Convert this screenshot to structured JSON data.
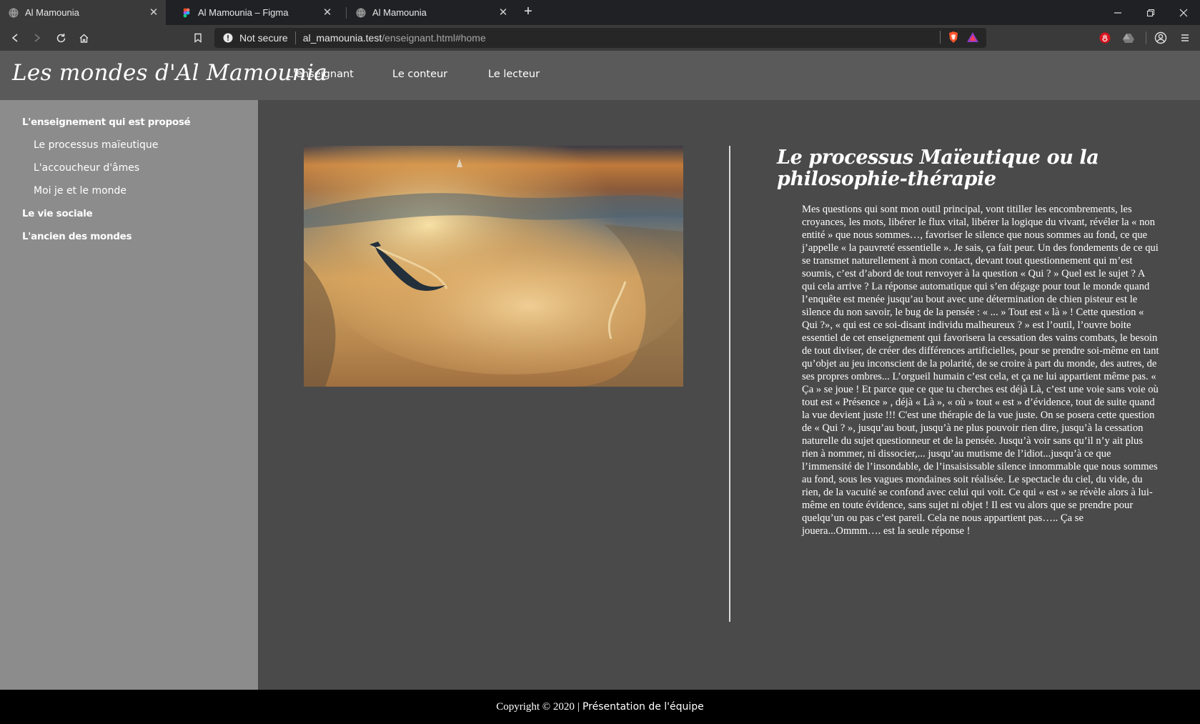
{
  "browser": {
    "tabs": [
      {
        "title": "Al Mamounia",
        "icon": "globe-icon",
        "active": true
      },
      {
        "title": "Al Mamounia – Figma",
        "icon": "figma-icon",
        "active": false
      },
      {
        "title": "Al Mamounia",
        "icon": "globe-icon",
        "active": false
      }
    ],
    "security_label": "Not secure",
    "url_host": "al_mamounia.test",
    "url_path": "/enseignant.html#home"
  },
  "site": {
    "logo": "Les mondes d'Al Mamounia",
    "nav": [
      {
        "label": "L'enseignant"
      },
      {
        "label": "Le conteur"
      },
      {
        "label": "Le lecteur"
      }
    ],
    "sidebar": {
      "section1": "L'enseignement qui est proposé",
      "sub": [
        {
          "label": "Le processus maïeutique"
        },
        {
          "label": "L'accoucheur d'âmes"
        },
        {
          "label": "Moi je et le monde"
        }
      ],
      "section2": "Le vie sociale",
      "section3": "L'ancien des mondes"
    },
    "article": {
      "title": "Le processus Maïeutique ou la philosophie-thérapie",
      "body": "Mes questions qui sont mon outil principal, vont titiller les encombrements, les croyances, les mots, libérer le flux vital, libérer la logique du vivant, révéler la « non entité » que nous sommes…, favoriser le silence que nous sommes au fond, ce que j’appelle « la pauvreté essentielle ». Je sais, ça fait peur. Un des fondements de ce qui se transmet naturellement à mon contact, devant tout questionnement qui m’est soumis, c’est d’abord de tout renvoyer à la question « Qui ? » Quel est le sujet ? A qui cela arrive ? La réponse automatique qui s’en dégage pour tout le monde quand l’enquête est menée jusqu’au bout avec une détermination de chien pisteur est le silence du non savoir, le bug de la pensée : « ... » Tout est « là » ! Cette question « Qui ?», « qui est ce soi-disant individu malheureux ? » est l’outil, l’ouvre boite essentiel de cet enseignement qui favorisera la cessation des vains combats, le besoin de tout diviser, de créer des différences artificielles, pour se prendre soi-même en tant qu’objet au jeu inconscient de la polarité, de se croire à part du monde, des autres, de ses propres ombres... L’orgueil humain c’est cela, et ça ne lui appartient même pas. « Ça » se joue ! Et parce que ce que tu cherches est déjà Là, c’est une voie sans voie où tout est « Présence » , déjà « Là », « où » tout « est » d’évidence, tout de suite quand la vue devient juste !!! C'est une thérapie de la vue juste. On se posera cette question de « Qui ? », jusqu’au bout, jusqu’à ne plus pouvoir rien dire, jusqu’à la cessation naturelle du sujet questionneur et de la pensée. Jusqu’à voir sans qu’il n’y ait plus rien à nommer, ni dissocier,... jusqu’au mutisme de l’idiot...jusqu’à ce que l’immensité de l’insondable, de l’insaisissable silence innommable que nous sommes au fond, sous les vagues mondaines soit réalisée. Le spectacle du ciel, du vide, du rien, de la vacuité se confond avec celui qui voit. Ce qui « est » se révèle alors à lui-même en toute évidence, sans sujet ni objet ! Il est vu alors que se prendre pour quelqu’un ou pas c’est pareil. Cela ne nous appartient pas….. Ça se jouera...Ommm…. est la seule réponse !"
    },
    "footer": {
      "copyright": "Copyright © 2020",
      "separator": "|",
      "team_link": "Présentation de l'équipe"
    }
  },
  "colors": {
    "header_bg": "#5a5a5a",
    "sidebar_bg": "#8c8c8c",
    "main_bg": "#4a4a4a",
    "footer_bg": "#000000",
    "text": "#ffffff"
  }
}
